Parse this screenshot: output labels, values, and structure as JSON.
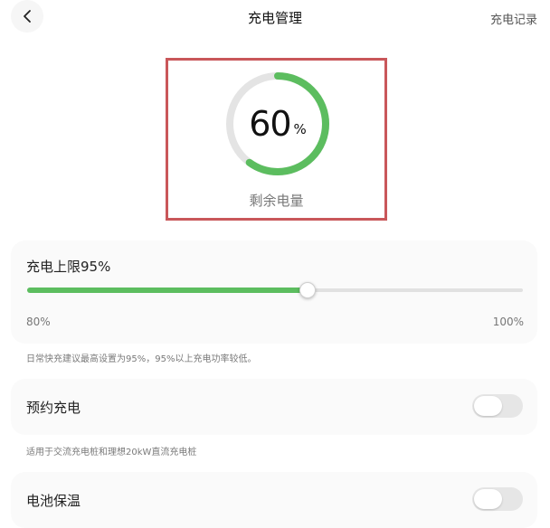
{
  "header": {
    "back_icon": "chevron-left-icon",
    "title": "充电管理",
    "history_label": "充电记录"
  },
  "battery": {
    "percent_value": "60",
    "percent_unit": "%",
    "level_fraction": 0.6,
    "label": "剩余电量",
    "ring_color": "#5cbd5f",
    "track_color": "#e4e4e4",
    "highlight_border_color": "#c9575a"
  },
  "charge_limit": {
    "label": "充电上限95%",
    "min_label": "80%",
    "max_label": "100%",
    "min_value": 80,
    "max_value": 100,
    "value": 95,
    "note": "日常快充建议最高设置为95%，95%以上充电功率较低。",
    "fill_color": "#5cbd5f"
  },
  "scheduled_charging": {
    "label": "预约充电",
    "enabled": false,
    "note": "适用于交流充电桩和理想20kW直流充电桩"
  },
  "battery_heating": {
    "label": "电池保温",
    "enabled": false
  }
}
